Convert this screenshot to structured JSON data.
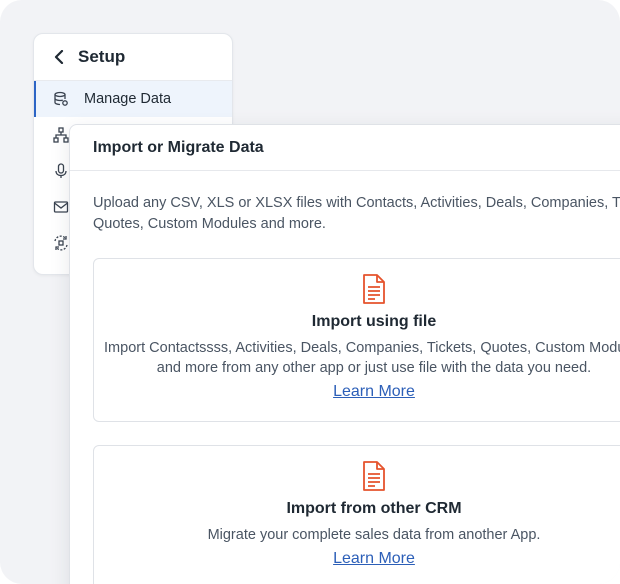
{
  "setup": {
    "title": "Setup",
    "items": [
      {
        "label": "Manage Data",
        "icon": "database-icon",
        "active": true
      },
      {
        "label": "",
        "icon": "sitemap-icon"
      },
      {
        "label": "",
        "icon": "microphone-icon"
      },
      {
        "label": "",
        "icon": "envelope-icon"
      },
      {
        "label": "",
        "icon": "sync-icon"
      }
    ]
  },
  "dialog": {
    "title": "Import or Migrate Data",
    "description_line1": "Upload any CSV, XLS or XLSX files with Contacts, Activities, Deals, Companies, Tickets,",
    "description_line2": "Quotes, Custom Modules and more.",
    "options": [
      {
        "title": "Import using file",
        "desc_line1": "Import Contactssss, Activities, Deals, Companies, Tickets, Quotes, Custom Modules",
        "desc_line2": "and more from any other app or just use file with the data you need.",
        "link": "Learn More",
        "icon": "document-icon"
      },
      {
        "title": "Import from other CRM",
        "desc_line1": "Migrate your complete sales data from another App.",
        "link": "Learn More",
        "icon": "document-icon"
      }
    ]
  },
  "colors": {
    "accent": "#2c64c5",
    "icon_orange": "#e5532d",
    "link": "#2c5fb8"
  }
}
